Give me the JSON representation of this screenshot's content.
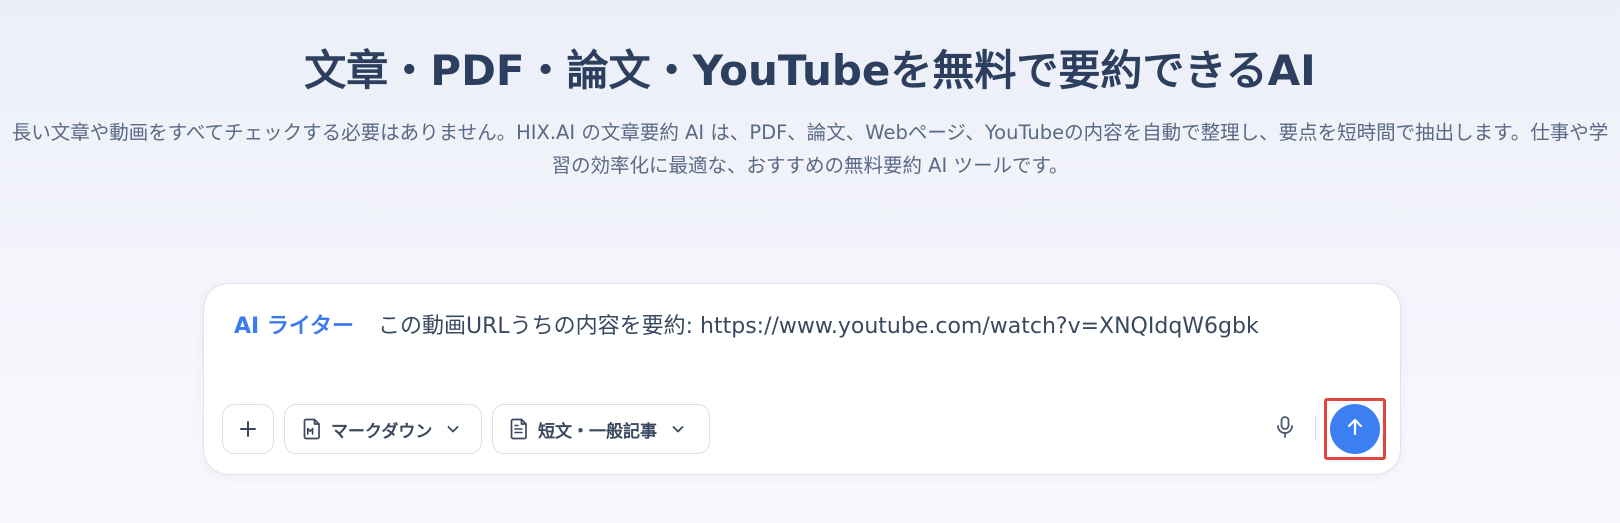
{
  "hero": {
    "title": "文章・PDF・論文・YouTubeを無料で要約できるAI",
    "description": "長い文章や動画をすべてチェックする必要はありません。HIX.AI の文章要約 AI は、PDF、論文、Webページ、YouTubeの内容を自動で整理し、要点を短時間で抽出します。仕事や学習の効率化に最適な、おすすめの無料要約 AI ツールです。"
  },
  "composer": {
    "mode_label": "AI ライター",
    "prompt_text": "この動画URLうちの内容を要約: https://www.youtube.com/watch?v=XNQIdqW6gbk",
    "format_label": "マークダウン",
    "length_label": "短文・一般記事"
  },
  "icons": {
    "add": "plus-icon",
    "format": "markdown-file-icon",
    "length": "document-icon",
    "chevron": "chevron-down-icon",
    "mic": "microphone-icon",
    "send": "arrow-up-icon"
  },
  "colors": {
    "accent": "#3b7ff2",
    "mode_tag": "#3b7bf0",
    "highlight_border": "#e0453c",
    "title": "#2d3f5e"
  }
}
